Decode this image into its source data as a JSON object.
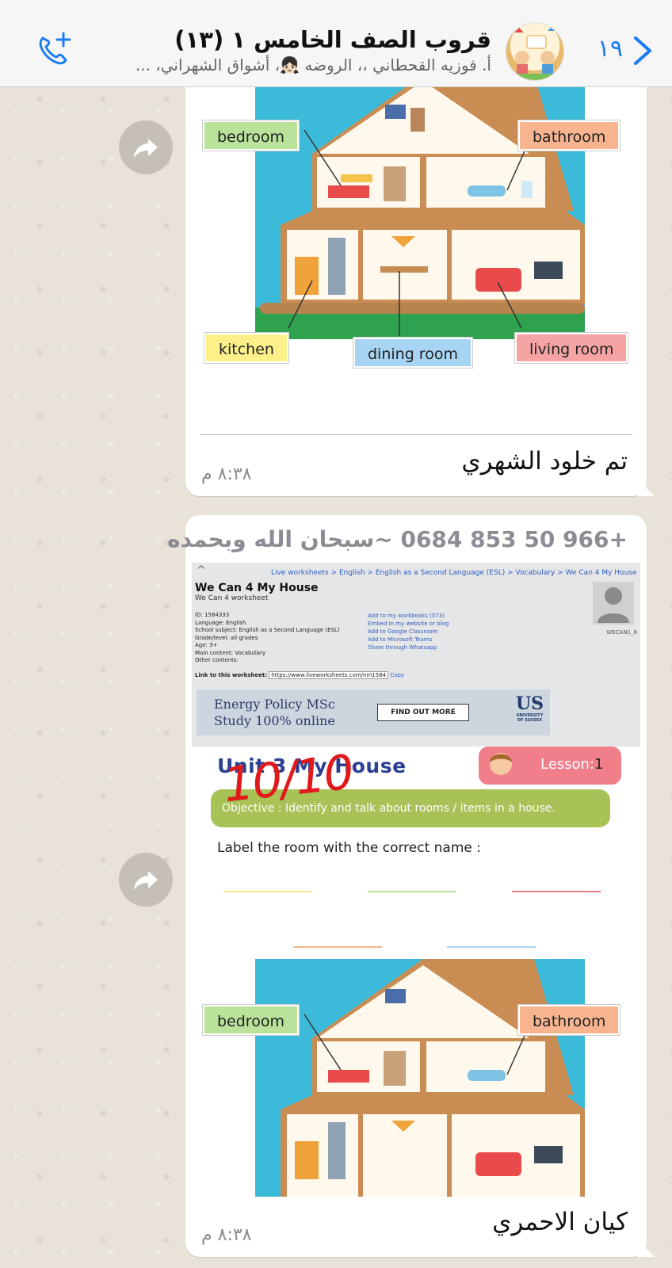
{
  "header": {
    "group_title": "قروب الصف الخامس ١ (١٣)",
    "members": "أ. فوزيه القحطاني ،، الروضه 👧🏻، أشواق الشهراني، ...",
    "unread_count": "١٩"
  },
  "messages": [
    {
      "text": "تم خلود الشهري",
      "time": "٨:٣٨ م",
      "image_labels": {
        "bedroom": "bedroom",
        "bathroom": "bathroom",
        "kitchen": "kitchen",
        "dining_room": "dining room",
        "living_room": "living room"
      }
    },
    {
      "sender": "+966 50 853 0684 ~سبحان الله وبحمده",
      "text": "كيان الاحمري",
      "time": "٨:٣٨ م",
      "worksheet": {
        "breadcrumb": "Live worksheets > English > English as a Second Language (ESL) > Vocabulary > We Can 4 My House",
        "title": "We Can 4 My House",
        "subtitle": "We Can 4 worksheet",
        "id": "ID: 1584333",
        "language": "Language: English",
        "school_subject": "School subject: English as a Second Language (ESL)",
        "grade": "Grade/level: all grades",
        "age": "Age: 3+",
        "main_content": "Main content: Vocabulary",
        "other_contents": "Other contents:",
        "links": [
          "Add to my workbooks (573)",
          "Embed in my website or blog",
          "Add to Google Classroom",
          "Add to Microsoft Teams",
          "Share through Whatsapp"
        ],
        "username": "WECAN1_6",
        "link_label": "Link to this worksheet:",
        "link_url": "https://www.liveworksheets.com/nm1584",
        "copy": "Copy",
        "ad_line1": "Energy Policy MSc",
        "ad_line2": "Study 100% online",
        "ad_button": "FIND OUT MORE",
        "ad_logo": "US",
        "ad_logo_sub1": "UNIVERSITY",
        "ad_logo_sub2": "OF SUSSEX",
        "unit_title": "Unit 3 My House",
        "lesson_label": "Lesson:",
        "lesson_number": "1",
        "objective": "Objective : Identify and talk about rooms / items in a house.",
        "instruction": "Label the room with the correct name :",
        "score": "10/10"
      },
      "image_labels": {
        "bedroom": "bedroom",
        "bathroom": "bathroom"
      }
    }
  ],
  "colors": {
    "accent_blue": "#1b7cf2",
    "bubble": "#ffffff",
    "chat_bg": "#e8e2d9",
    "label_green": "#b9e29b",
    "label_orange": "#f8b48f",
    "label_yellow": "#fdf08a",
    "label_blue": "#a7d4f3",
    "label_pink": "#f5a3a3",
    "sky": "#3bbbd9",
    "grass": "#2ea24e"
  }
}
